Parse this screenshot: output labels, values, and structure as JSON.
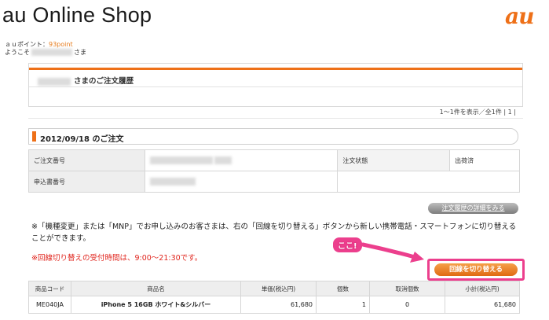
{
  "header": {
    "site_title": "au Online Shop",
    "logo_text": "au"
  },
  "user": {
    "points_label": "ａｕポイント：",
    "points_value": "93point",
    "welcome_prefix": "ようこそ",
    "welcome_suffix": "さま"
  },
  "history": {
    "title": "さまのご注文履歴",
    "pager": "1～1件を表示／全1件 | 1 |"
  },
  "order": {
    "heading": "2012/09/18 のご注文",
    "rows": [
      {
        "label": "ご注文番号",
        "label2": "注文状態",
        "value2": "出荷済"
      },
      {
        "label": "申込書番号"
      }
    ],
    "detail_button": "注文履歴の詳細をみる"
  },
  "notice": {
    "text": "※「機種変更」または「MNP」でお申し込みのお客さまは、右の「回線を切り替える」ボタンから新しい携帯電話・スマートフォンに切り替えることができます。",
    "warning": "※回線切り替えの受付時間は、9:00～21:30です。"
  },
  "annotation": {
    "callout": "ここ!"
  },
  "switch_button": "回線を切り替える",
  "items_table": {
    "headers": [
      "商品コード",
      "商品名",
      "単価(税込円)",
      "個数",
      "取消個数",
      "小計(税込円)"
    ],
    "rows": [
      [
        "ME040JA",
        "iPhone 5 16GB ホワイト&シルバー",
        "61,680",
        "1",
        "0",
        "61,680"
      ]
    ]
  },
  "colors": {
    "accent": "#ee7018",
    "callout": "#ec3f8d",
    "warning": "#e0241c"
  }
}
